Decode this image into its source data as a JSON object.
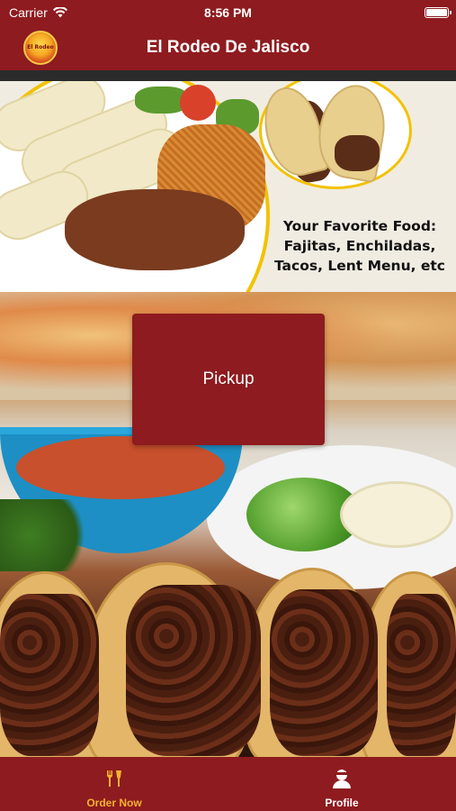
{
  "status_bar": {
    "carrier": "Carrier",
    "time": "8:56 PM"
  },
  "nav": {
    "title": "El Rodeo De Jalisco",
    "logo_text": "El Rodeo"
  },
  "banner": {
    "text_lines": [
      "Your Favorite Food:",
      "Fajitas, Enchiladas,",
      "Tacos, Lent Menu, etc"
    ]
  },
  "main": {
    "pickup_label": "Pickup"
  },
  "tab_bar": {
    "tabs": [
      {
        "label": "Order Now",
        "icon": "utensils-icon",
        "active": true
      },
      {
        "label": "Profile",
        "icon": "profile-icon",
        "active": false
      }
    ]
  },
  "colors": {
    "brand": "#8e1b1f",
    "active_tab": "#f2b233",
    "inactive_tab": "#ffffff"
  }
}
